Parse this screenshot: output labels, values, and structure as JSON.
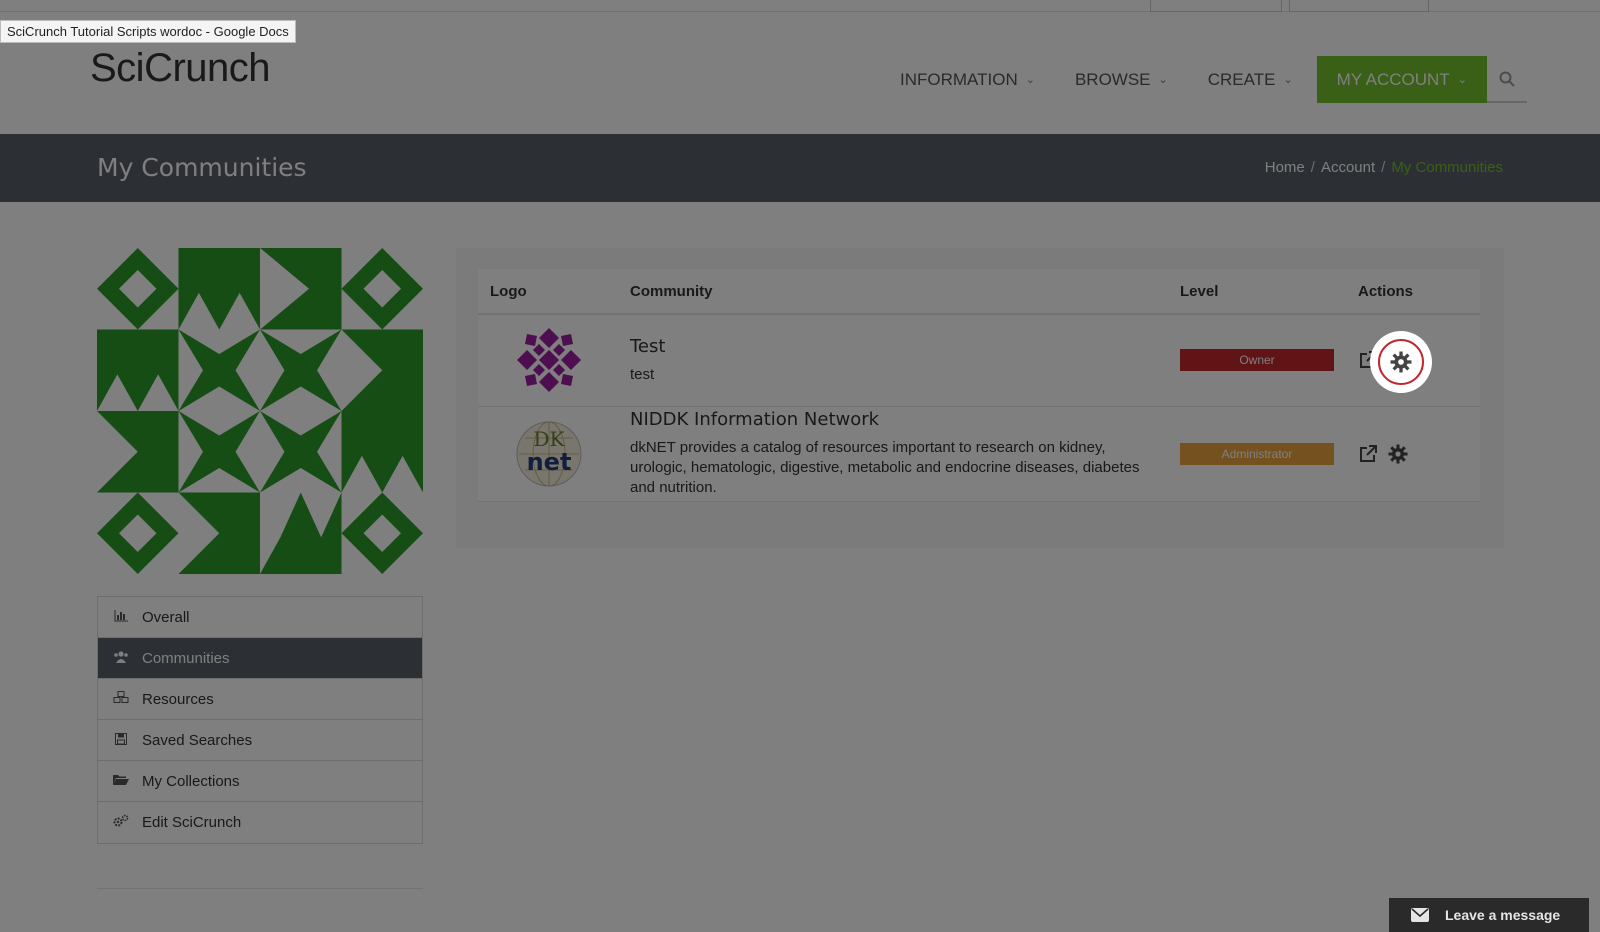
{
  "tooltip": "SciCrunch Tutorial Scripts wordoc - Google Docs",
  "header": {
    "logo": "SciCrunch",
    "nav": {
      "information": "INFORMATION",
      "browse": "BROWSE",
      "create": "CREATE",
      "account": "MY ACCOUNT"
    },
    "search_icon": "search-icon"
  },
  "titlebar": {
    "title": "My Communities",
    "crumbs": {
      "home": "Home",
      "account": "Account",
      "current": "My Communities",
      "separator": "/"
    }
  },
  "sidebar": {
    "items": [
      {
        "label": "Overall",
        "icon": "bar-chart-icon"
      },
      {
        "label": "Communities",
        "icon": "users-icon"
      },
      {
        "label": "Resources",
        "icon": "cubes-icon"
      },
      {
        "label": "Saved Searches",
        "icon": "save-icon"
      },
      {
        "label": "My Collections",
        "icon": "folder-open-icon"
      },
      {
        "label": "Edit SciCrunch",
        "icon": "cogs-icon"
      }
    ]
  },
  "table": {
    "headers": {
      "logo": "Logo",
      "community": "Community",
      "level": "Level",
      "actions": "Actions"
    },
    "rows": [
      {
        "name": "Test",
        "description": "test",
        "level": "Owner",
        "level_color": "#c0282d"
      },
      {
        "name": "NIDDK Information Network",
        "description": "dkNET provides a catalog of resources important to research on kidney, urologic, hematologic, digestive, metabolic and endocrine diseases, diabetes and nutrition.",
        "level": "Administrator",
        "level_color": "#e8a33d"
      }
    ]
  },
  "dknet_logo": {
    "top": "DK",
    "bottom": "net"
  },
  "chat": {
    "label": "Leave a message"
  },
  "colors": {
    "accent": "#72c02c",
    "bar": "#585f69"
  }
}
